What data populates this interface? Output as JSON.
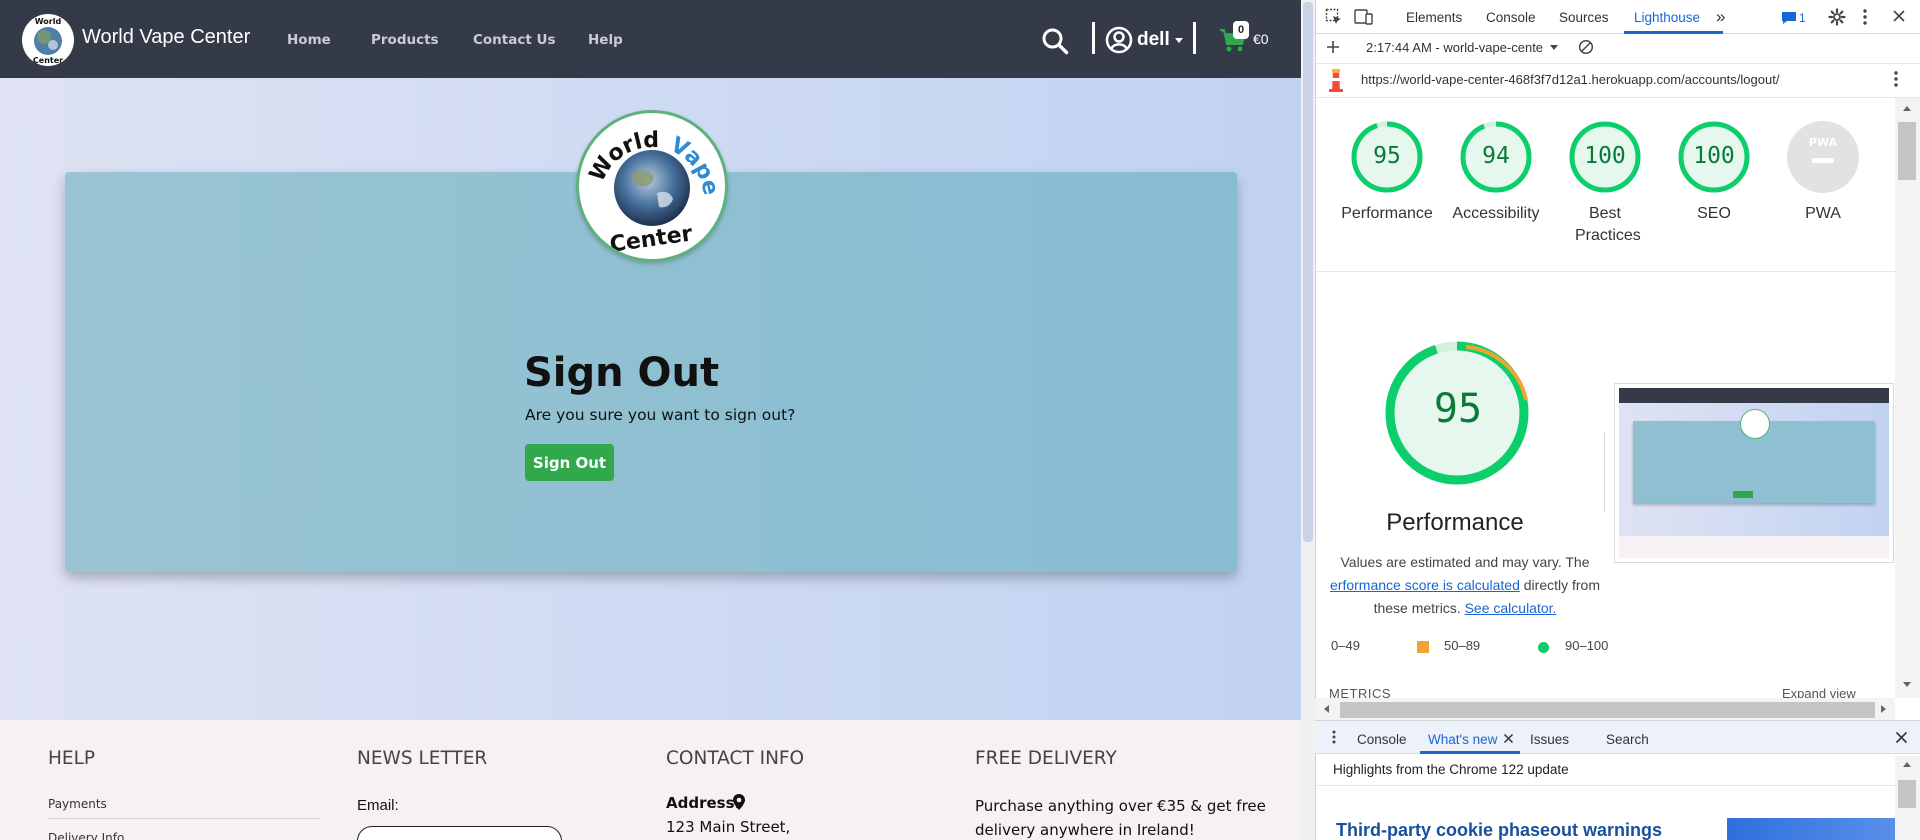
{
  "site": {
    "brand": "World Vape Center",
    "logo_text_top": "World",
    "logo_text_accent": "Vape",
    "logo_text_bottom": "Center",
    "nav": [
      "Home",
      "Products",
      "Contact Us",
      "Help"
    ],
    "user": "dell",
    "cart_count": "0",
    "cart_total": "€0",
    "signout": {
      "title": "Sign Out",
      "question": "Are you sure you want to sign out?",
      "button": "Sign Out"
    },
    "footer": {
      "help_head": "HELP",
      "help_links": [
        "Payments",
        "Delivery Info"
      ],
      "news_head": "NEWS LETTER",
      "email_label": "Email:",
      "contact_head": "CONTACT INFO",
      "address_label": "Address:",
      "address_line": "123 Main Street,",
      "free_head": "FREE DELIVERY",
      "free_text": "Purchase anything over €35 & get free delivery anywhere in Ireland!"
    }
  },
  "devtools": {
    "tabs": [
      "Elements",
      "Console",
      "Sources",
      "Lighthouse"
    ],
    "active_tab": "Lighthouse",
    "issues_badge": "1",
    "report_time": "2:17:44 AM - world-vape-cente",
    "url": "https://world-vape-center-468f3f7d12a1.herokuapp.com/accounts/logout/",
    "scores": [
      {
        "label": "Performance",
        "value": 95
      },
      {
        "label": "Accessibility",
        "value": 94
      },
      {
        "label": "Best Practices",
        "value": 100
      },
      {
        "label": "SEO",
        "value": 100
      },
      {
        "label": "PWA",
        "value": null
      }
    ],
    "pwa_badge": "PWA",
    "big_score": "95",
    "big_title": "Performance",
    "note_start": "Values are estimated and may vary. The",
    "note_link1": "erformance score is calculated",
    "note_mid": " directly from these metrics.",
    "note_link2": "See calculator.",
    "legend": [
      "0–49",
      "50–89",
      "90–100"
    ],
    "metrics_head": "METRICS",
    "expand_view": "Expand view",
    "drawer_tabs": [
      "Console",
      "What's new",
      "Issues",
      "Search"
    ],
    "drawer_active": "What's new",
    "highlights": "Highlights from the Chrome 122 update",
    "news_title": "Third-party cookie phaseout warnings"
  },
  "colors": {
    "nav_bg": "#343a47",
    "card_bg": "#8fc0d2",
    "button_green": "#2fa94b",
    "score_green": "#0cce6b",
    "score_orange": "#f0a32e",
    "devtools_blue": "#1a66d3"
  }
}
